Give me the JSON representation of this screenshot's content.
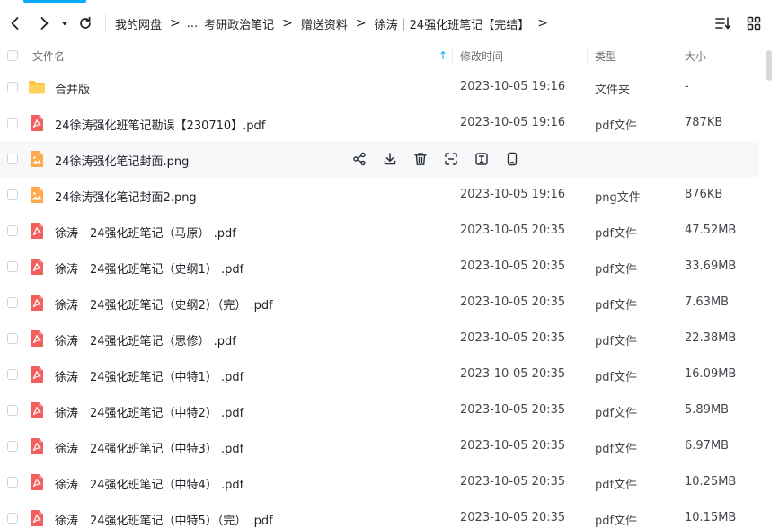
{
  "theme": {
    "accent": "#06a7ff",
    "pdf_color": "#f25f5c",
    "folder_color": "#ffc43d",
    "png_color": "#ffa94d"
  },
  "toolbar": {
    "back_icon": "chevron-left-icon",
    "forward_icon": "chevron-right-icon",
    "history_icon": "caret-down-icon",
    "refresh_icon": "refresh-icon",
    "sort_icon": "sort-list-icon",
    "grid_icon": "grid-view-icon"
  },
  "breadcrumb": {
    "items": [
      "我的网盘",
      "...",
      "考研政治笔记",
      "赠送资料",
      "徐涛｜24强化班笔记【完结】"
    ],
    "separator": ">"
  },
  "header": {
    "name": "文件名",
    "time": "修改时间",
    "type": "类型",
    "size": "大小",
    "sort_indicator": "↑"
  },
  "row_actions": [
    "share-icon",
    "download-icon",
    "delete-icon",
    "scan-icon",
    "text-extract-icon",
    "phone-icon"
  ],
  "files": [
    {
      "icon": "folder-icon",
      "name": "合并版",
      "time": "2023-10-05 19:16",
      "type": "文件夹",
      "size": "-"
    },
    {
      "icon": "pdf-icon",
      "name": "24徐涛强化班笔记勘误【230710】.pdf",
      "time": "2023-10-05 19:16",
      "type": "pdf文件",
      "size": "787KB"
    },
    {
      "icon": "image-icon",
      "name": "24徐涛强化笔记封面.png",
      "time": "",
      "type": "",
      "size": "",
      "hover": true
    },
    {
      "icon": "image-icon",
      "name": "24徐涛强化笔记封面2.png",
      "time": "2023-10-05 19:16",
      "type": "png文件",
      "size": "876KB"
    },
    {
      "icon": "pdf-icon",
      "name": "徐涛｜24强化班笔记（马原） .pdf",
      "time": "2023-10-05 20:35",
      "type": "pdf文件",
      "size": "47.52MB"
    },
    {
      "icon": "pdf-icon",
      "name": "徐涛｜24强化班笔记（史纲1） .pdf",
      "time": "2023-10-05 20:35",
      "type": "pdf文件",
      "size": "33.69MB"
    },
    {
      "icon": "pdf-icon",
      "name": "徐涛｜24强化班笔记（史纲2）（完） .pdf",
      "time": "2023-10-05 20:35",
      "type": "pdf文件",
      "size": "7.63MB"
    },
    {
      "icon": "pdf-icon",
      "name": "徐涛｜24强化班笔记（思修） .pdf",
      "time": "2023-10-05 20:35",
      "type": "pdf文件",
      "size": "22.38MB"
    },
    {
      "icon": "pdf-icon",
      "name": "徐涛｜24强化班笔记（中特1） .pdf",
      "time": "2023-10-05 20:35",
      "type": "pdf文件",
      "size": "16.09MB"
    },
    {
      "icon": "pdf-icon",
      "name": "徐涛｜24强化班笔记（中特2） .pdf",
      "time": "2023-10-05 20:35",
      "type": "pdf文件",
      "size": "5.89MB"
    },
    {
      "icon": "pdf-icon",
      "name": "徐涛｜24强化班笔记（中特3） .pdf",
      "time": "2023-10-05 20:35",
      "type": "pdf文件",
      "size": "6.97MB"
    },
    {
      "icon": "pdf-icon",
      "name": "徐涛｜24强化班笔记（中特4） .pdf",
      "time": "2023-10-05 20:35",
      "type": "pdf文件",
      "size": "10.25MB"
    },
    {
      "icon": "pdf-icon",
      "name": "徐涛｜24强化班笔记（中特5）（完） .pdf",
      "time": "2023-10-05 20:35",
      "type": "pdf文件",
      "size": "10.15MB"
    }
  ]
}
